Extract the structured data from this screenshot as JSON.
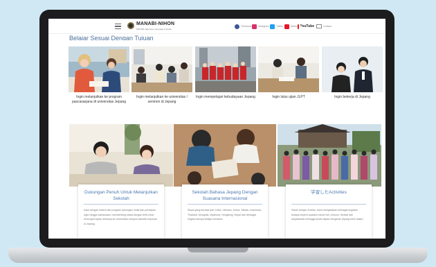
{
  "header": {
    "logo_text": "MANABI-NIHON",
    "logo_subtext": "MANABI Japanese Language Institute",
    "social": [
      {
        "icon": "facebook-icon",
        "label": "Facebook",
        "color": "#3b5998"
      },
      {
        "icon": "instagram-icon",
        "label": "Instagram",
        "color": "#d6336c"
      },
      {
        "icon": "twitter-icon",
        "label": "Twitter",
        "color": "#1da1f2"
      },
      {
        "icon": "weibo-icon",
        "label": "Weibo",
        "color": "#e6162d"
      },
      {
        "icon": "youtube-icon",
        "label": "YouTube",
        "color": "#e02020"
      },
      {
        "icon": "mail-icon",
        "label": "Contact",
        "color": "#888888"
      }
    ]
  },
  "section_title": "Belajar Sesuai Dengan Tujuan",
  "purposes": [
    {
      "caption": "Ingin melanjutkan ke program pascasarjana di universitas Jepang"
    },
    {
      "caption": "Ingin melanjutkan ke universitas / senmon di Jepang"
    },
    {
      "caption": "Ingin mempelajari kebudayaan Jepang"
    },
    {
      "caption": "Ingin lulus ujian JLPT"
    },
    {
      "caption": "Ingin bekerja di Jepang"
    }
  ],
  "features": [
    {
      "title": "Dukungan Penuh Untuk Melanjutkan Sekolah",
      "body": "Kami dengan sistem dan program dukungan mulai dari persiapan ujian hingga wawancara, membimbing siswa dengan teliti untuk mencapai tujuan studinya ke universitas maupun sekolah kejuruan di Jepang."
    },
    {
      "title": "Sekolah Bahasa Jepang Dengan Suasana Internasional",
      "body": "Siswa yang berasal dari China, Vietnam, Korea, Taiwan, Indonesia, Thailand, Mongolia, Myanmar, Hongkong, Nepal dan berbagai negara lainnya belajar bersama."
    },
    {
      "title": "学習したActivities",
      "body": "Selain belajar di kelas, kami mengadakan berbagai kegiatan budaya seperti upacara minum teh, kimono, festival dan karyawisata sehingga siswa dapat mengenal Jepang lebih dalam."
    }
  ]
}
